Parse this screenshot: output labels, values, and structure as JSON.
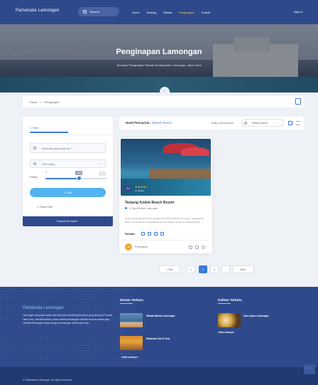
{
  "nav": {
    "brand": "Pariwisata Lamongan",
    "search": "Telusuri",
    "links": [
      "Home",
      "Tentang",
      "Wisata",
      "Penginapan",
      "Kuliner"
    ],
    "active": "Penginapan",
    "signin": "Sign In"
  },
  "hero": {
    "title": "Penginapan Lamongan",
    "subtitle": "Temukan Penginapan Terbaik di Kabupaten Lamongan, Jawa Timur"
  },
  "breadcrumb": {
    "home": "Home",
    "sep": "›",
    "current": "Penginapan"
  },
  "filter": {
    "tab": "Filter",
    "name_placeholder": "Mulai apa yang anda cari ?",
    "category": "Cari Lokasi",
    "range_label": "Rating",
    "range_min": "0",
    "slider_value": "4.0",
    "slider_fraction": 0.55,
    "search_button": "Cari",
    "reset": "Reset Filter",
    "contact_button": "Kontak ke Kami"
  },
  "results": {
    "title": "Hasil Pencarian :",
    "query": "Beach Resort",
    "sort_label": "Urutkan Berdasarkan:",
    "sort_value": "Paling Populer"
  },
  "property": {
    "rating": "4.0",
    "stars": "★★★★☆",
    "reviews": "(1 Ulasan)",
    "name": "Tanjung Kodok Beach Resort",
    "location": "Jl. Raya Paciran, Lamongan",
    "description": "Tanjung Kodok Beach Resort terletak dekat Wisata Bahari Lamongan, menawarkan kolam renang dengan pemandangan laut dan akses mudah ke destinasi pantai.",
    "facilities_label": "Fasilitas :",
    "category": "Penginapan"
  },
  "pagination": {
    "prev": "‹ Prev",
    "pages": [
      "1",
      "2",
      "3",
      "..."
    ],
    "active": "2",
    "next": "Next ›"
  },
  "footer": {
    "brand": "Pariwisata Lamongan",
    "about": "Lamongan merupakan salah satu kota yang memiliki garis pantai yang ada pada Provinsi Jawa Timur. Memiliki daerah pesisir membuat lamongan memiliki ciri khas wisata yang memiliki keberagam wisata maupun menyimpan aneka kulinernya.",
    "wisata_title": "Wisata Terbaru",
    "wisata_items": [
      "Wisata Bahari Lamongan",
      "Maharani Zoo & Goa"
    ],
    "wisata_more": "Lihat Lainnya",
    "kuliner_title": "Kuliner Terbaru",
    "kuliner_items": [
      "Soto Ayam Lamongan"
    ],
    "kuliner_more": "Lihat Lainnya",
    "copyright": "© Pariwisata Lamongan. All rights reserved."
  }
}
